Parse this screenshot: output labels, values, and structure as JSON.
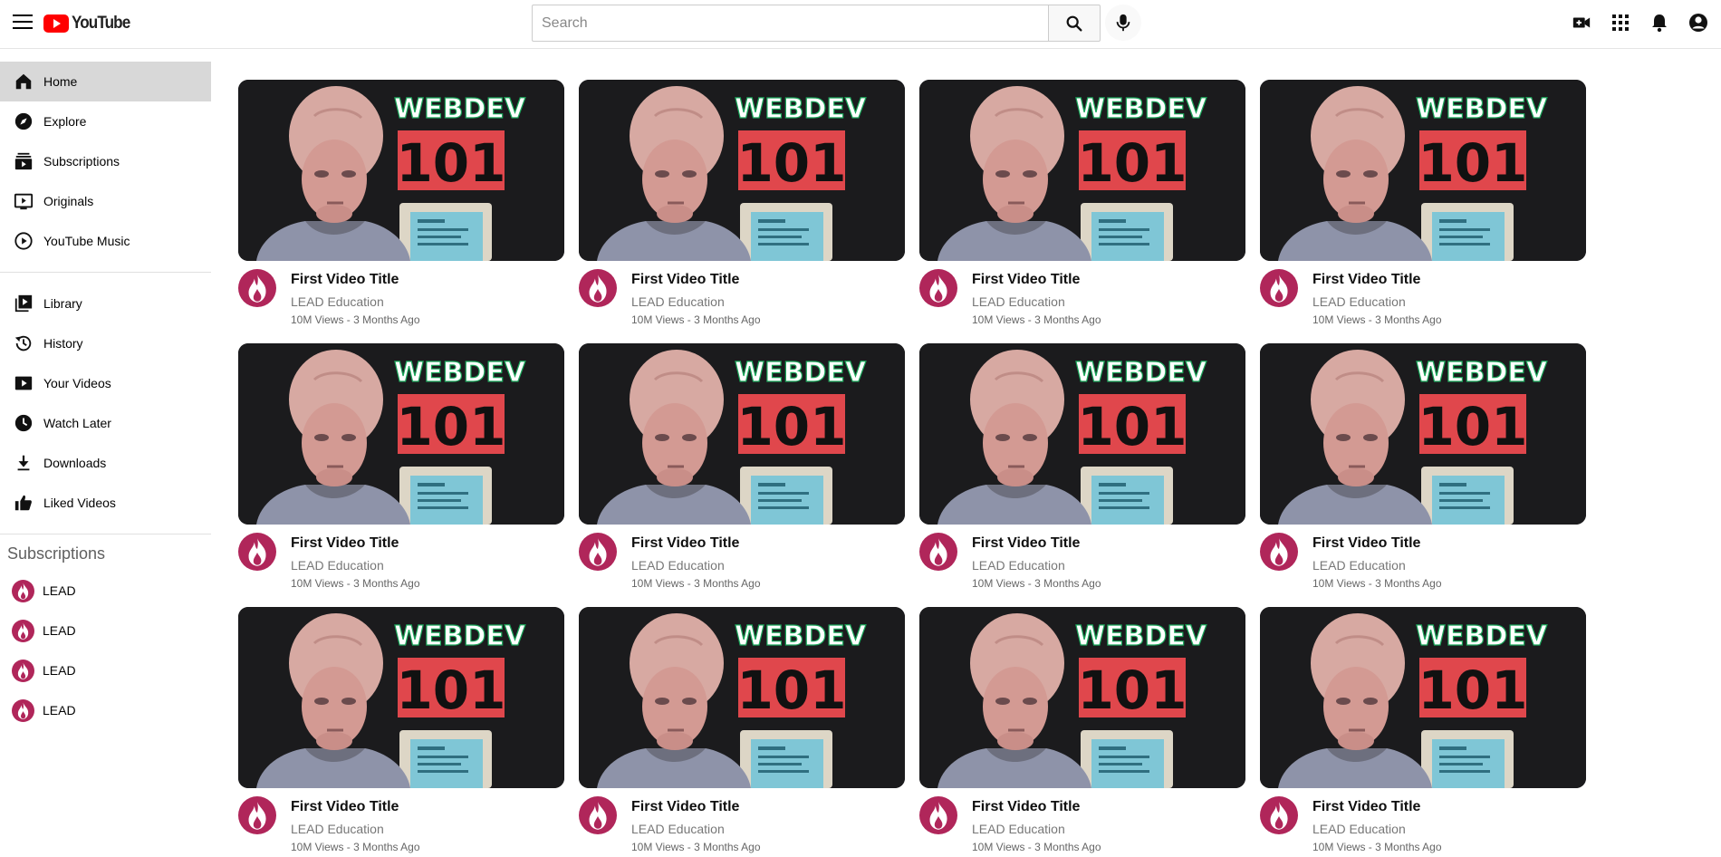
{
  "app": {
    "logo_text": "YouTube"
  },
  "search": {
    "placeholder": "Search",
    "value": ""
  },
  "colors": {
    "brand": "#ff0000",
    "channel_avatar": "#b0265a",
    "thumbnail_bg": "#1b1b1d",
    "thumbnail_badge": "#e0474c",
    "thumbnail_webdev": "#1aa65a"
  },
  "top_actions": [
    "create-video-icon",
    "apps-grid-icon",
    "notifications-bell-icon",
    "account-icon"
  ],
  "sidebar": {
    "primary": [
      {
        "label": "Home",
        "icon": "home-icon",
        "active": true
      },
      {
        "label": "Explore",
        "icon": "explore-compass-icon"
      },
      {
        "label": "Subscriptions",
        "icon": "subscriptions-icon"
      },
      {
        "label": "Originals",
        "icon": "originals-icon"
      },
      {
        "label": "YouTube Music",
        "icon": "youtube-music-icon"
      }
    ],
    "secondary": [
      {
        "label": "Library",
        "icon": "library-icon"
      },
      {
        "label": "History",
        "icon": "history-icon"
      },
      {
        "label": "Your Videos",
        "icon": "your-videos-icon"
      },
      {
        "label": "Watch Later",
        "icon": "watch-later-clock-icon"
      },
      {
        "label": "Downloads",
        "icon": "download-icon"
      },
      {
        "label": "Liked Videos",
        "icon": "thumbs-up-icon"
      }
    ],
    "subscriptions_heading": "Subscriptions",
    "subscriptions": [
      {
        "label": "LEAD"
      },
      {
        "label": "LEAD"
      },
      {
        "label": "LEAD"
      },
      {
        "label": "LEAD"
      }
    ]
  },
  "thumbnail": {
    "word": "WEBDEV",
    "number": "101"
  },
  "videos": [
    {
      "title": "First Video Title",
      "channel": "LEAD Education",
      "stats": "10M Views - 3 Months Ago"
    },
    {
      "title": "First Video Title",
      "channel": "LEAD Education",
      "stats": "10M Views - 3 Months Ago"
    },
    {
      "title": "First Video Title",
      "channel": "LEAD Education",
      "stats": "10M Views - 3 Months Ago"
    },
    {
      "title": "First Video Title",
      "channel": "LEAD Education",
      "stats": "10M Views - 3 Months Ago"
    },
    {
      "title": "First Video Title",
      "channel": "LEAD Education",
      "stats": "10M Views - 3 Months Ago"
    },
    {
      "title": "First Video Title",
      "channel": "LEAD Education",
      "stats": "10M Views - 3 Months Ago"
    },
    {
      "title": "First Video Title",
      "channel": "LEAD Education",
      "stats": "10M Views - 3 Months Ago"
    },
    {
      "title": "First Video Title",
      "channel": "LEAD Education",
      "stats": "10M Views - 3 Months Ago"
    },
    {
      "title": "First Video Title",
      "channel": "LEAD Education",
      "stats": "10M Views - 3 Months Ago"
    },
    {
      "title": "First Video Title",
      "channel": "LEAD Education",
      "stats": "10M Views - 3 Months Ago"
    },
    {
      "title": "First Video Title",
      "channel": "LEAD Education",
      "stats": "10M Views - 3 Months Ago"
    },
    {
      "title": "First Video Title",
      "channel": "LEAD Education",
      "stats": "10M Views - 3 Months Ago"
    }
  ]
}
